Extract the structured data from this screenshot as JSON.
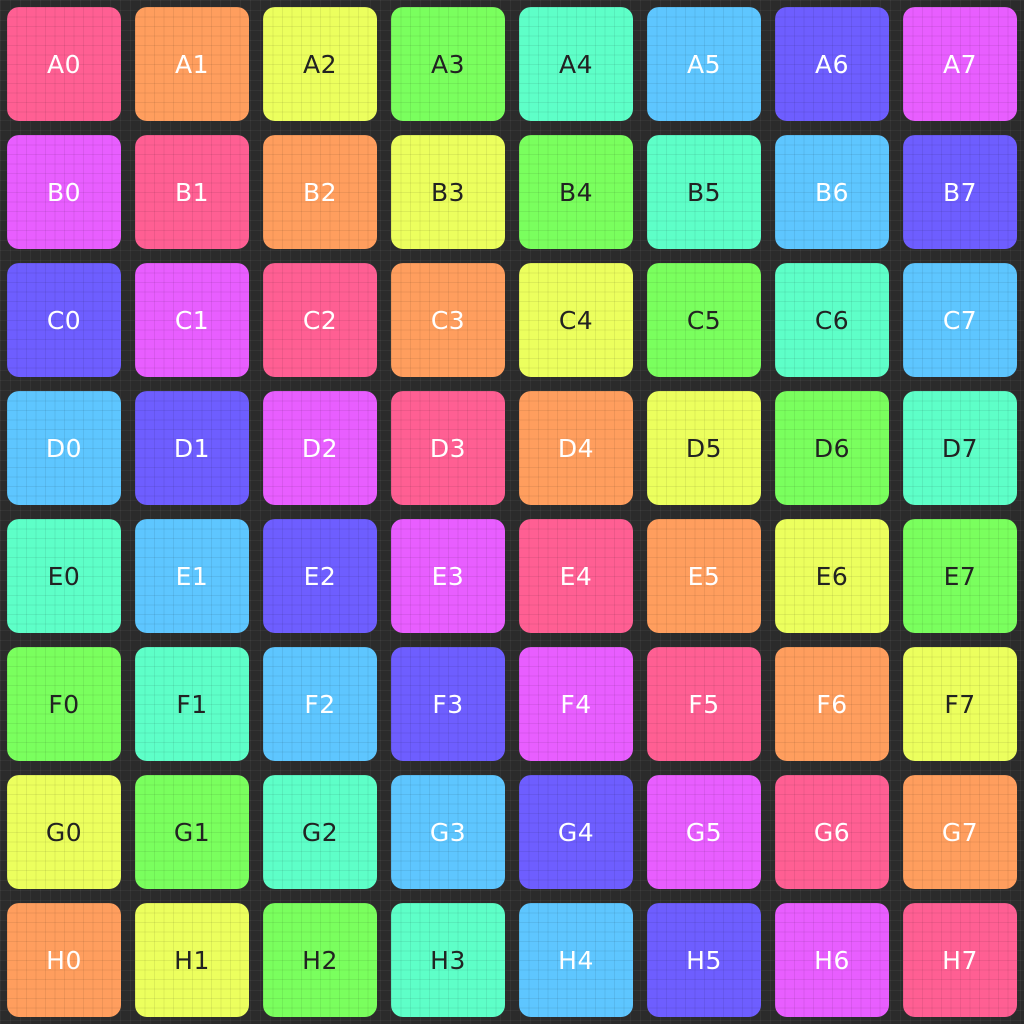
{
  "palette": [
    "#ff5f93",
    "#ff9e5e",
    "#ecff5e",
    "#7aff5e",
    "#5effc8",
    "#5ec6ff",
    "#6e5eff",
    "#e85eff"
  ],
  "text_colors": [
    "#ffffff",
    "#ffffff",
    "#222222",
    "#222222",
    "#222222",
    "#ffffff",
    "#ffffff",
    "#ffffff"
  ],
  "rows": [
    "A",
    "B",
    "C",
    "D",
    "E",
    "F",
    "G",
    "H"
  ],
  "cells": [
    [
      "A0",
      "A1",
      "A2",
      "A3",
      "A4",
      "A5",
      "A6",
      "A7"
    ],
    [
      "B0",
      "B1",
      "B2",
      "B3",
      "B4",
      "B5",
      "B6",
      "B7"
    ],
    [
      "C0",
      "C1",
      "C2",
      "C3",
      "C4",
      "C5",
      "C6",
      "C7"
    ],
    [
      "D0",
      "D1",
      "D2",
      "D3",
      "D4",
      "D5",
      "D6",
      "D7"
    ],
    [
      "E0",
      "E1",
      "E2",
      "E3",
      "E4",
      "E5",
      "E6",
      "E7"
    ],
    [
      "F0",
      "F1",
      "F2",
      "F3",
      "F4",
      "F5",
      "F6",
      "F7"
    ],
    [
      "G0",
      "G1",
      "G2",
      "G3",
      "G4",
      "G5",
      "G6",
      "G7"
    ],
    [
      "H0",
      "H1",
      "H2",
      "H3",
      "H4",
      "H5",
      "H6",
      "H7"
    ]
  ]
}
